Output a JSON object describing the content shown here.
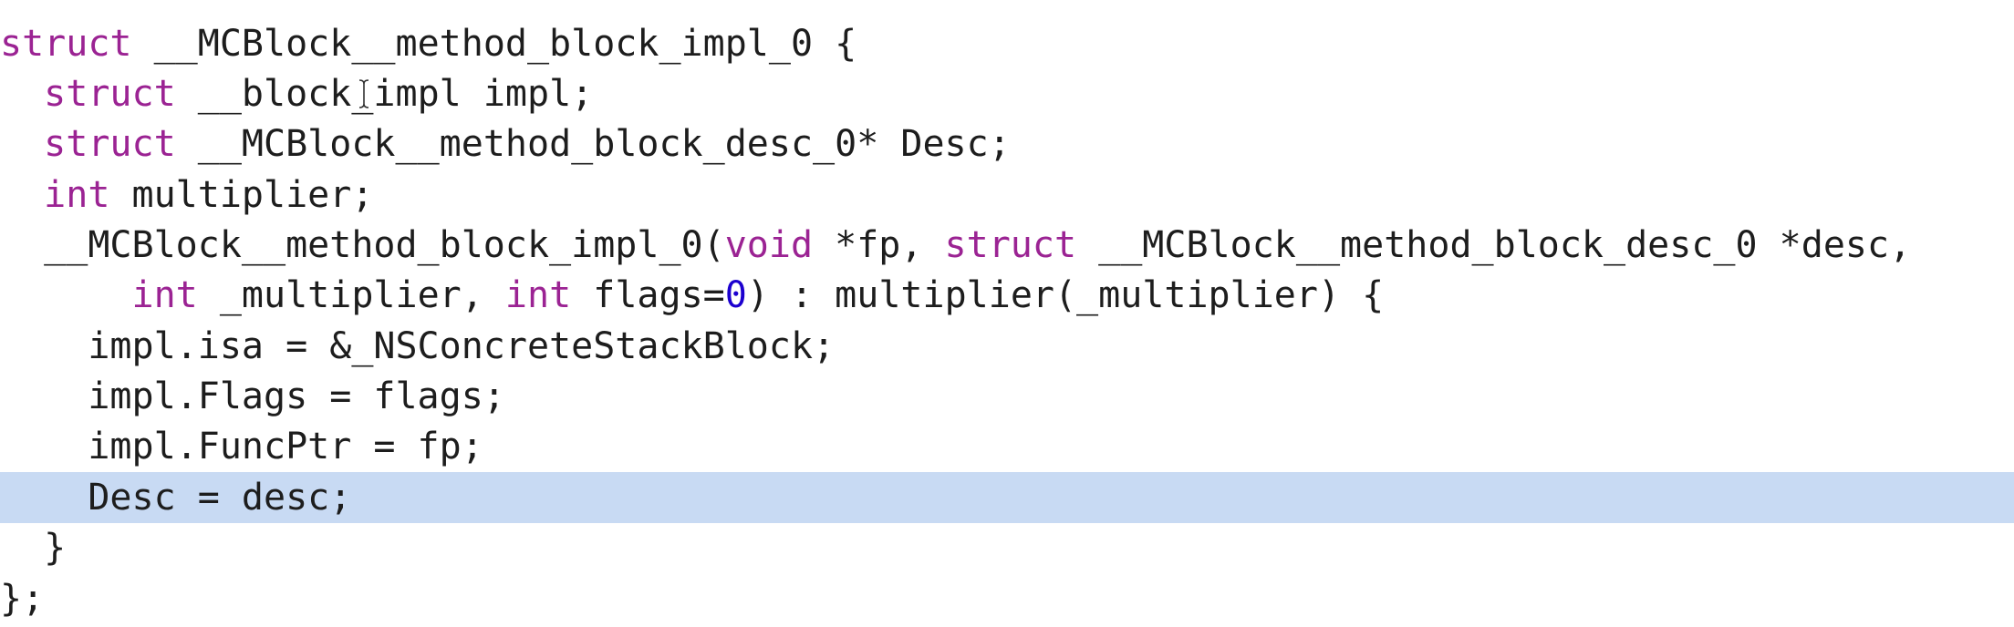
{
  "editor": {
    "highlight_color": "#c8daf3",
    "keyword_color": "#9b2393",
    "number_color": "#1c00cf",
    "text_color": "#1d1d1d",
    "cursor_icon": "text-cursor-icon",
    "lines": [
      {
        "tokens": [
          {
            "text": "struct",
            "kind": "kw"
          },
          {
            "text": " __MCBlock__method_block_impl_0 {",
            "kind": "plain"
          }
        ]
      },
      {
        "tokens": [
          {
            "text": "  ",
            "kind": "plain"
          },
          {
            "text": "struct",
            "kind": "kw"
          },
          {
            "text": " __block_impl impl;",
            "kind": "plain"
          }
        ]
      },
      {
        "tokens": [
          {
            "text": "  ",
            "kind": "plain"
          },
          {
            "text": "struct",
            "kind": "kw"
          },
          {
            "text": " __MCBlock__method_block_desc_0* Desc;",
            "kind": "plain"
          }
        ]
      },
      {
        "tokens": [
          {
            "text": "  ",
            "kind": "plain"
          },
          {
            "text": "int",
            "kind": "kw"
          },
          {
            "text": " multiplier;",
            "kind": "plain"
          }
        ]
      },
      {
        "tokens": [
          {
            "text": "  __MCBlock__method_block_impl_0(",
            "kind": "plain"
          },
          {
            "text": "void",
            "kind": "kw"
          },
          {
            "text": " *fp, ",
            "kind": "plain"
          },
          {
            "text": "struct",
            "kind": "kw"
          },
          {
            "text": " __MCBlock__method_block_desc_0 *desc,",
            "kind": "plain"
          }
        ]
      },
      {
        "tokens": [
          {
            "text": "      ",
            "kind": "plain"
          },
          {
            "text": "int",
            "kind": "kw"
          },
          {
            "text": " _multiplier, ",
            "kind": "plain"
          },
          {
            "text": "int",
            "kind": "kw"
          },
          {
            "text": " flags=",
            "kind": "plain"
          },
          {
            "text": "0",
            "kind": "num"
          },
          {
            "text": ") : multiplier(_multiplier) {",
            "kind": "plain"
          }
        ]
      },
      {
        "tokens": [
          {
            "text": "    impl.isa = &_NSConcreteStackBlock;",
            "kind": "plain"
          }
        ]
      },
      {
        "tokens": [
          {
            "text": "    impl.Flags = flags;",
            "kind": "plain"
          }
        ]
      },
      {
        "tokens": [
          {
            "text": "    impl.FuncPtr = fp;",
            "kind": "plain"
          }
        ]
      },
      {
        "highlighted": true,
        "tokens": [
          {
            "text": "    Desc = desc;",
            "kind": "plain"
          }
        ]
      },
      {
        "tokens": [
          {
            "text": "  }",
            "kind": "plain"
          }
        ]
      },
      {
        "tokens": [
          {
            "text": "};",
            "kind": "plain"
          }
        ]
      }
    ]
  }
}
